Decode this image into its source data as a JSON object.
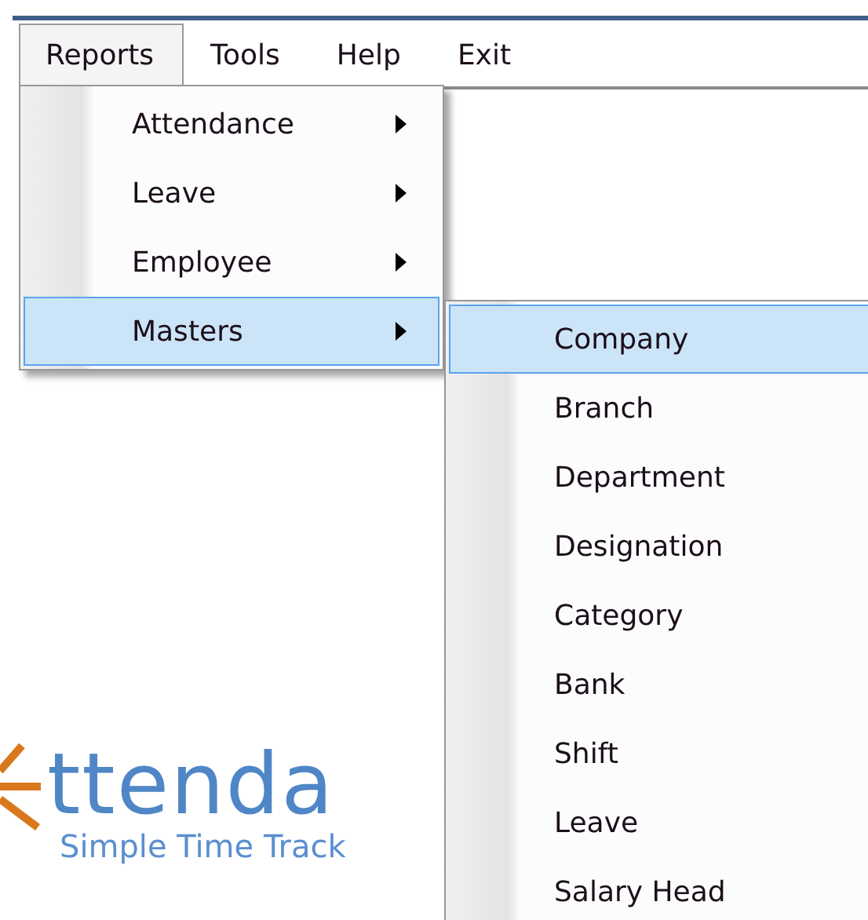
{
  "menu_bar": [
    {
      "label": "Reports",
      "selected": true
    },
    {
      "label": "Tools",
      "selected": false
    },
    {
      "label": "Help",
      "selected": false
    },
    {
      "label": "Exit",
      "selected": false
    }
  ],
  "dropdown": {
    "items": [
      {
        "label": "Attendance",
        "selected": false
      },
      {
        "label": "Leave",
        "selected": false
      },
      {
        "label": "Employee",
        "selected": false
      },
      {
        "label": "Masters",
        "selected": true
      }
    ]
  },
  "submenu": {
    "items": [
      {
        "label": "Company",
        "selected": true
      },
      {
        "label": "Branch",
        "selected": false
      },
      {
        "label": "Department",
        "selected": false
      },
      {
        "label": "Designation",
        "selected": false
      },
      {
        "label": "Category",
        "selected": false
      },
      {
        "label": "Bank",
        "selected": false
      },
      {
        "label": "Shift",
        "selected": false
      },
      {
        "label": "Leave",
        "selected": false
      },
      {
        "label": "Salary Head",
        "selected": false
      }
    ]
  },
  "logo": {
    "wordmark": "ttenda",
    "tagline": "Simple Time Track"
  }
}
